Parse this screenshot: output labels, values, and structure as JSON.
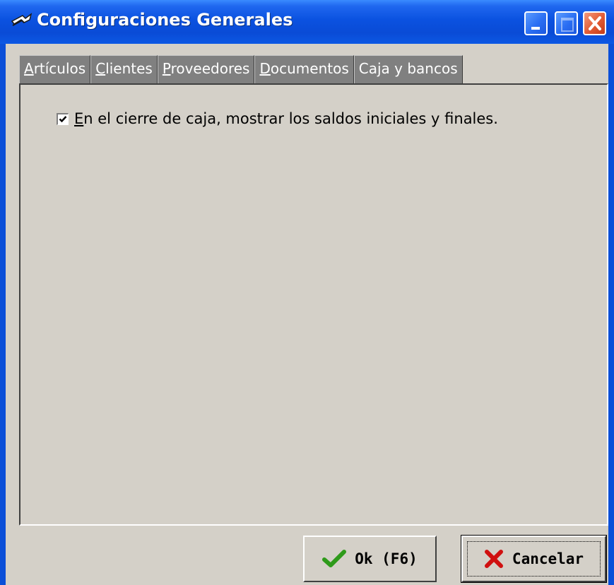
{
  "window": {
    "title": "Configuraciones Generales",
    "icon": "app-icon"
  },
  "titlebar_buttons": {
    "minimize": "minimize-icon",
    "maximize": "maximize-icon",
    "close": "close-icon"
  },
  "tabs": [
    {
      "label": "Artículos",
      "mnemonic": "A",
      "rest": "rtículos",
      "active": false
    },
    {
      "label": "Clientes",
      "mnemonic": "C",
      "rest": "lientes",
      "active": false
    },
    {
      "label": "Proveedores",
      "mnemonic": "P",
      "rest": "roveedores",
      "active": false
    },
    {
      "label": "Documentos",
      "mnemonic": "D",
      "rest": "ocumentos",
      "active": false
    },
    {
      "label": "Caja y bancos",
      "mnemonic": "",
      "rest": "Caja y bancos",
      "active": true
    }
  ],
  "options": {
    "show_balances": {
      "checked": true,
      "mnemonic": "E",
      "rest": "n el cierre de caja, mostrar los saldos iniciales y finales."
    }
  },
  "buttons": {
    "ok_label": "Ok (F6)",
    "cancel_label": "Cancelar"
  },
  "colors": {
    "titlebar": "#0b52e0",
    "client": "#d4d0c8",
    "tab_bg": "#808080",
    "ok_icon": "#2e9a1a",
    "cancel_icon": "#d01010"
  }
}
